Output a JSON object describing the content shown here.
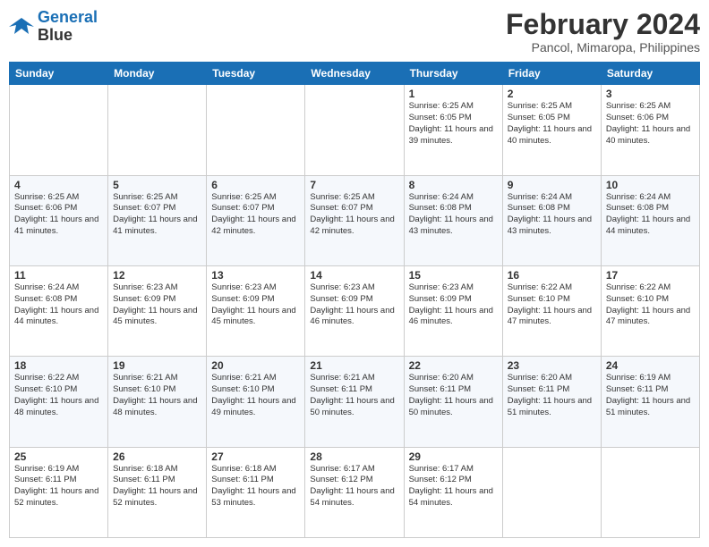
{
  "header": {
    "logo_line1": "General",
    "logo_line2": "Blue",
    "month_year": "February 2024",
    "location": "Pancol, Mimaropa, Philippines"
  },
  "days_of_week": [
    "Sunday",
    "Monday",
    "Tuesday",
    "Wednesday",
    "Thursday",
    "Friday",
    "Saturday"
  ],
  "weeks": [
    [
      {
        "day": "",
        "info": ""
      },
      {
        "day": "",
        "info": ""
      },
      {
        "day": "",
        "info": ""
      },
      {
        "day": "",
        "info": ""
      },
      {
        "day": "1",
        "info": "Sunrise: 6:25 AM\nSunset: 6:05 PM\nDaylight: 11 hours and 39 minutes."
      },
      {
        "day": "2",
        "info": "Sunrise: 6:25 AM\nSunset: 6:05 PM\nDaylight: 11 hours and 40 minutes."
      },
      {
        "day": "3",
        "info": "Sunrise: 6:25 AM\nSunset: 6:06 PM\nDaylight: 11 hours and 40 minutes."
      }
    ],
    [
      {
        "day": "4",
        "info": "Sunrise: 6:25 AM\nSunset: 6:06 PM\nDaylight: 11 hours and 41 minutes."
      },
      {
        "day": "5",
        "info": "Sunrise: 6:25 AM\nSunset: 6:07 PM\nDaylight: 11 hours and 41 minutes."
      },
      {
        "day": "6",
        "info": "Sunrise: 6:25 AM\nSunset: 6:07 PM\nDaylight: 11 hours and 42 minutes."
      },
      {
        "day": "7",
        "info": "Sunrise: 6:25 AM\nSunset: 6:07 PM\nDaylight: 11 hours and 42 minutes."
      },
      {
        "day": "8",
        "info": "Sunrise: 6:24 AM\nSunset: 6:08 PM\nDaylight: 11 hours and 43 minutes."
      },
      {
        "day": "9",
        "info": "Sunrise: 6:24 AM\nSunset: 6:08 PM\nDaylight: 11 hours and 43 minutes."
      },
      {
        "day": "10",
        "info": "Sunrise: 6:24 AM\nSunset: 6:08 PM\nDaylight: 11 hours and 44 minutes."
      }
    ],
    [
      {
        "day": "11",
        "info": "Sunrise: 6:24 AM\nSunset: 6:08 PM\nDaylight: 11 hours and 44 minutes."
      },
      {
        "day": "12",
        "info": "Sunrise: 6:23 AM\nSunset: 6:09 PM\nDaylight: 11 hours and 45 minutes."
      },
      {
        "day": "13",
        "info": "Sunrise: 6:23 AM\nSunset: 6:09 PM\nDaylight: 11 hours and 45 minutes."
      },
      {
        "day": "14",
        "info": "Sunrise: 6:23 AM\nSunset: 6:09 PM\nDaylight: 11 hours and 46 minutes."
      },
      {
        "day": "15",
        "info": "Sunrise: 6:23 AM\nSunset: 6:09 PM\nDaylight: 11 hours and 46 minutes."
      },
      {
        "day": "16",
        "info": "Sunrise: 6:22 AM\nSunset: 6:10 PM\nDaylight: 11 hours and 47 minutes."
      },
      {
        "day": "17",
        "info": "Sunrise: 6:22 AM\nSunset: 6:10 PM\nDaylight: 11 hours and 47 minutes."
      }
    ],
    [
      {
        "day": "18",
        "info": "Sunrise: 6:22 AM\nSunset: 6:10 PM\nDaylight: 11 hours and 48 minutes."
      },
      {
        "day": "19",
        "info": "Sunrise: 6:21 AM\nSunset: 6:10 PM\nDaylight: 11 hours and 48 minutes."
      },
      {
        "day": "20",
        "info": "Sunrise: 6:21 AM\nSunset: 6:10 PM\nDaylight: 11 hours and 49 minutes."
      },
      {
        "day": "21",
        "info": "Sunrise: 6:21 AM\nSunset: 6:11 PM\nDaylight: 11 hours and 50 minutes."
      },
      {
        "day": "22",
        "info": "Sunrise: 6:20 AM\nSunset: 6:11 PM\nDaylight: 11 hours and 50 minutes."
      },
      {
        "day": "23",
        "info": "Sunrise: 6:20 AM\nSunset: 6:11 PM\nDaylight: 11 hours and 51 minutes."
      },
      {
        "day": "24",
        "info": "Sunrise: 6:19 AM\nSunset: 6:11 PM\nDaylight: 11 hours and 51 minutes."
      }
    ],
    [
      {
        "day": "25",
        "info": "Sunrise: 6:19 AM\nSunset: 6:11 PM\nDaylight: 11 hours and 52 minutes."
      },
      {
        "day": "26",
        "info": "Sunrise: 6:18 AM\nSunset: 6:11 PM\nDaylight: 11 hours and 52 minutes."
      },
      {
        "day": "27",
        "info": "Sunrise: 6:18 AM\nSunset: 6:11 PM\nDaylight: 11 hours and 53 minutes."
      },
      {
        "day": "28",
        "info": "Sunrise: 6:17 AM\nSunset: 6:12 PM\nDaylight: 11 hours and 54 minutes."
      },
      {
        "day": "29",
        "info": "Sunrise: 6:17 AM\nSunset: 6:12 PM\nDaylight: 11 hours and 54 minutes."
      },
      {
        "day": "",
        "info": ""
      },
      {
        "day": "",
        "info": ""
      }
    ]
  ]
}
